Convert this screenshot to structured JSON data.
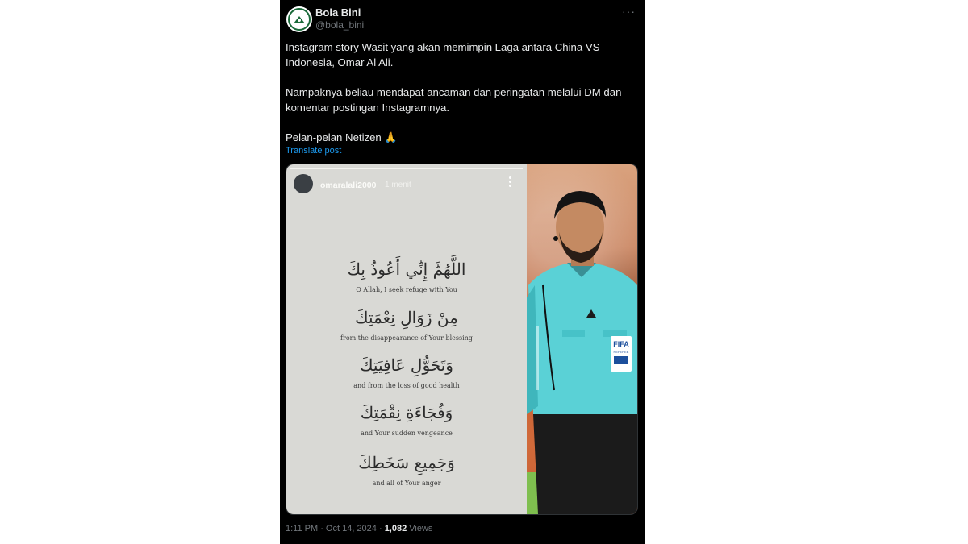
{
  "author": {
    "name": "Bola Bini",
    "handle": "@bola_bini"
  },
  "post": {
    "paragraphs": [
      "Instagram story Wasit yang akan memimpin Laga antara China VS\nIndonesia, Omar Al Ali.",
      "Nampaknya beliau mendapat ancaman dan peringatan melalui DM dan\nkomentar postingan Instagramnya.",
      "Pelan-pelan Netizen 🙏"
    ],
    "translate_label": "Translate post",
    "more_label": "···"
  },
  "story": {
    "username": "omaralali2000",
    "time": "1 menit",
    "verses": [
      {
        "arabic": "اللَّهُمَّ إِنِّي أَعُوذُ بِكَ",
        "english": "O Allah, I seek refuge with You"
      },
      {
        "arabic": "مِنْ زَوَالِ نِعْمَتِكَ",
        "english": "from the disappearance of Your blessing"
      },
      {
        "arabic": "وَتَحَوُّلِ عَافِيَتِكَ",
        "english": "and from the loss of good health"
      },
      {
        "arabic": "وَفُجَاءَةِ نِقْمَتِكَ",
        "english": "and Your sudden vengeance"
      },
      {
        "arabic": "وَجَمِيعِ سَخَطِكَ",
        "english": "and all of Your anger"
      }
    ]
  },
  "photo": {
    "badge_text": "FIFA",
    "badge_sub": "REFEREE"
  },
  "meta": {
    "time": "1:11 PM · Oct 14, 2024 · ",
    "views_count": "1,082",
    "views_label": " Views"
  },
  "colors": {
    "background": "#000000",
    "text": "#e7e9ea",
    "muted": "#71767b",
    "link": "#1d9bf0",
    "story_bg": "#d9d9d5",
    "jersey": "#5ad1d6"
  }
}
